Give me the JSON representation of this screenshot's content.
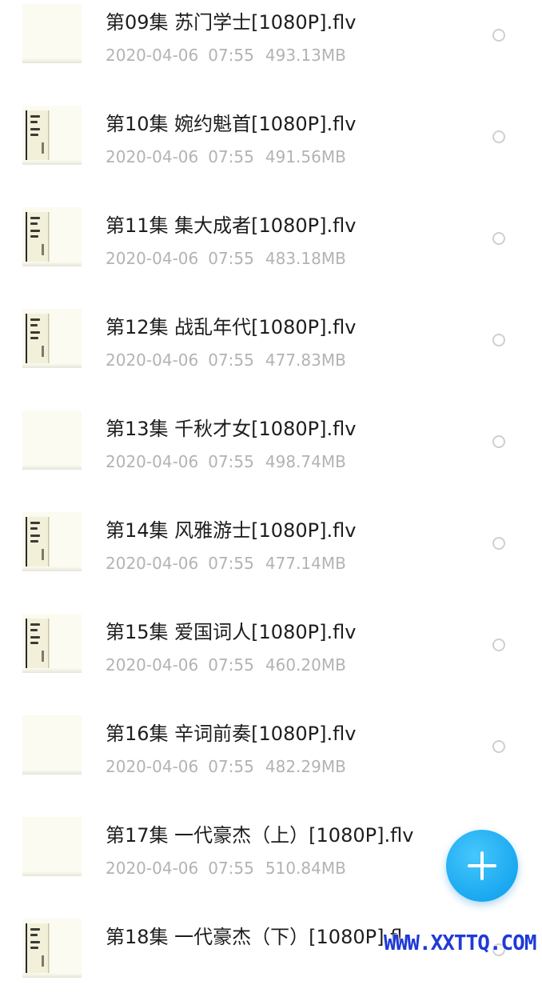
{
  "files": [
    {
      "title": "第09集 苏门学士[1080P].flv",
      "date": "2020-04-06",
      "time": "07:55",
      "size": "493.13MB",
      "thumbnail": "blank"
    },
    {
      "title": "第10集 婉约魁首[1080P].flv",
      "date": "2020-04-06",
      "time": "07:55",
      "size": "491.56MB",
      "thumbnail": "book-cover"
    },
    {
      "title": "第11集 集大成者[1080P].flv",
      "date": "2020-04-06",
      "time": "07:55",
      "size": "483.18MB",
      "thumbnail": "book-cover"
    },
    {
      "title": "第12集 战乱年代[1080P].flv",
      "date": "2020-04-06",
      "time": "07:55",
      "size": "477.83MB",
      "thumbnail": "book-cover"
    },
    {
      "title": "第13集 千秋才女[1080P].flv",
      "date": "2020-04-06",
      "time": "07:55",
      "size": "498.74MB",
      "thumbnail": "blank"
    },
    {
      "title": "第14集 风雅游士[1080P].flv",
      "date": "2020-04-06",
      "time": "07:55",
      "size": "477.14MB",
      "thumbnail": "book-cover"
    },
    {
      "title": "第15集 爱国词人[1080P].flv",
      "date": "2020-04-06",
      "time": "07:55",
      "size": "460.20MB",
      "thumbnail": "book-cover"
    },
    {
      "title": "第16集 辛词前奏[1080P].flv",
      "date": "2020-04-06",
      "time": "07:55",
      "size": "482.29MB",
      "thumbnail": "blank"
    },
    {
      "title": "第17集 一代豪杰（上）[1080P].flv",
      "date": "2020-04-06",
      "time": "07:55",
      "size": "510.84MB",
      "thumbnail": "blank"
    },
    {
      "title": "第18集 一代豪杰（下）[1080P].fl",
      "date": "",
      "time": "",
      "size": "",
      "thumbnail": "book-cover"
    }
  ],
  "fab": {
    "icon": "plus-icon"
  },
  "watermark": {
    "text": "WWW.XXTTQ.COM"
  },
  "colors": {
    "title": "#1d1d1d",
    "meta": "#b3b3b3",
    "radio_border": "#cfcfcf",
    "fab": "#1aa8f0",
    "watermark": "#1f3ad8"
  }
}
